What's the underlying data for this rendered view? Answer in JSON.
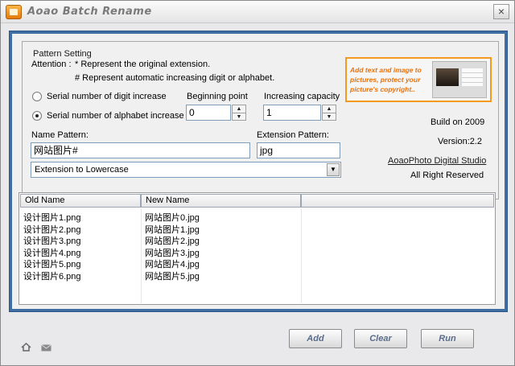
{
  "window": {
    "title": "Aoao Batch Rename"
  },
  "pattern": {
    "group_title": "Pattern Setting",
    "attention_label": "Attention :",
    "attention_line1": "* Represent the original extension.",
    "attention_line2": "# Represent automatic increasing digit or alphabet.",
    "radio_digit": "Serial number of digit increase",
    "radio_alpha": "Serial number of alphabet increase",
    "beginning_label": "Beginning point",
    "beginning_value": "0",
    "capacity_label": "Increasing capacity",
    "capacity_value": "1",
    "name_label": "Name Pattern:",
    "name_value": "网站图片#",
    "ext_label": "Extension Pattern:",
    "ext_value": "jpg",
    "case_selected": "Extension to Lowercase"
  },
  "ad": {
    "text": "Add text and image to pictures, protect your picture's copyright.."
  },
  "info": {
    "build": "Build on 2009",
    "version": "Version:2.2",
    "studio": "AoaoPhoto Digital Studio",
    "rights": "All Right Reserved"
  },
  "table": {
    "headers": [
      "Old Name",
      "New Name",
      ""
    ],
    "rows": [
      [
        "设计图片1.png",
        "网站图片0.jpg"
      ],
      [
        "设计图片2.png",
        "网站图片1.jpg"
      ],
      [
        "设计图片3.png",
        "网站图片2.jpg"
      ],
      [
        "设计图片4.png",
        "网站图片3.jpg"
      ],
      [
        "设计图片5.png",
        "网站图片4.jpg"
      ],
      [
        "设计图片6.png",
        "网站图片5.jpg"
      ]
    ]
  },
  "buttons": {
    "add": "Add",
    "clear": "Clear",
    "run": "Run"
  },
  "icons": {
    "app": "app-icon",
    "close": "close-icon",
    "home": "home-icon",
    "mail": "mail-icon",
    "dropdown": "chevron-down-icon"
  },
  "colors": {
    "frame": "#3f6ea3",
    "accent": "#f39a1f",
    "button_text": "#5a6c8a"
  }
}
